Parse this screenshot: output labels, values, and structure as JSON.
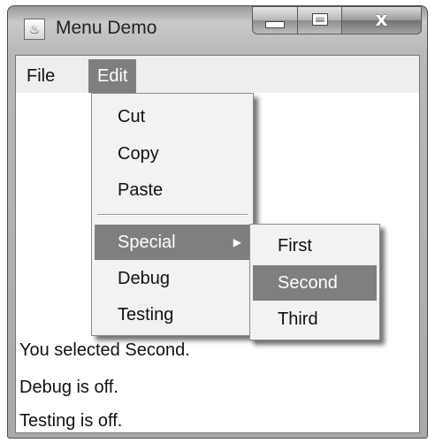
{
  "window": {
    "title": "Menu Demo",
    "controls": {
      "minimize": "minimize",
      "maximize": "maximize",
      "close": "x"
    }
  },
  "menubar": {
    "items": [
      {
        "label": "File"
      },
      {
        "label": "Edit",
        "active": true
      }
    ]
  },
  "edit_menu": {
    "items": [
      {
        "label": "Cut"
      },
      {
        "label": "Copy"
      },
      {
        "label": "Paste"
      },
      {
        "label": "Special",
        "has_submenu": true,
        "selected": true
      },
      {
        "label": "Debug"
      },
      {
        "label": "Testing"
      }
    ]
  },
  "special_menu": {
    "items": [
      {
        "label": "First"
      },
      {
        "label": "Second",
        "selected": true
      },
      {
        "label": "Third"
      }
    ]
  },
  "status": {
    "selection": "You selected Second.",
    "debug": "Debug is off.",
    "testing": "Testing is off."
  },
  "colors": {
    "selection_bg": "#7f7f7f",
    "selection_fg": "#ffffff",
    "menu_bg": "#f2f2f2"
  }
}
